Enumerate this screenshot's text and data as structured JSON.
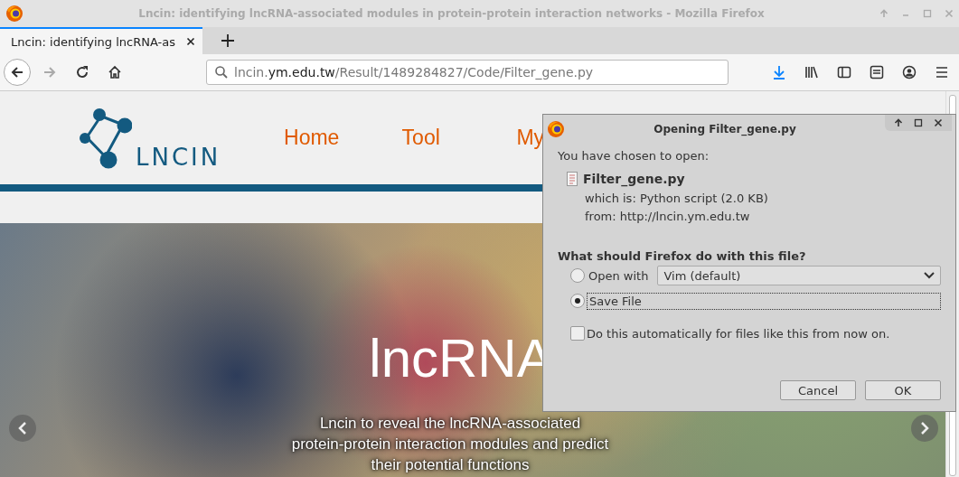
{
  "window": {
    "title": "Lncin: identifying lncRNA-associated modules in protein-protein interaction networks - Mozilla Firefox"
  },
  "tabs": [
    {
      "label": "Lncin: identifying lncRNA-as",
      "selected": true
    }
  ],
  "url": {
    "host_prefix": "lncin.",
    "host": "ym.edu.tw",
    "path": "/Result/1489284827/Code/Filter_gene.py"
  },
  "site": {
    "logo_text": "LNCIN",
    "nav": [
      "Home",
      "Tool",
      "My"
    ],
    "hero_title": "lncRNA",
    "hero_lines": [
      "Lncin to reveal the lncRNA-associated",
      "protein-protein interaction modules and predict",
      "their potential functions"
    ]
  },
  "dialog": {
    "title": "Opening Filter_gene.py",
    "intro": "You have chosen to open:",
    "file_name": "Filter_gene.py",
    "type_label": "which is:",
    "type_value": "Python script (2.0 KB)",
    "from_label": "from:",
    "from_value": "http://lncin.ym.edu.tw",
    "question": "What should Firefox do with this file?",
    "options": [
      {
        "kind": "open",
        "label": "Open with",
        "selected": false
      },
      {
        "kind": "save",
        "label": "Save File",
        "selected": true
      }
    ],
    "app": "Vim (default)",
    "auto": {
      "label": "Do this automatically for files like this from now on.",
      "checked": false
    },
    "buttons": [
      "Cancel",
      "OK"
    ]
  }
}
